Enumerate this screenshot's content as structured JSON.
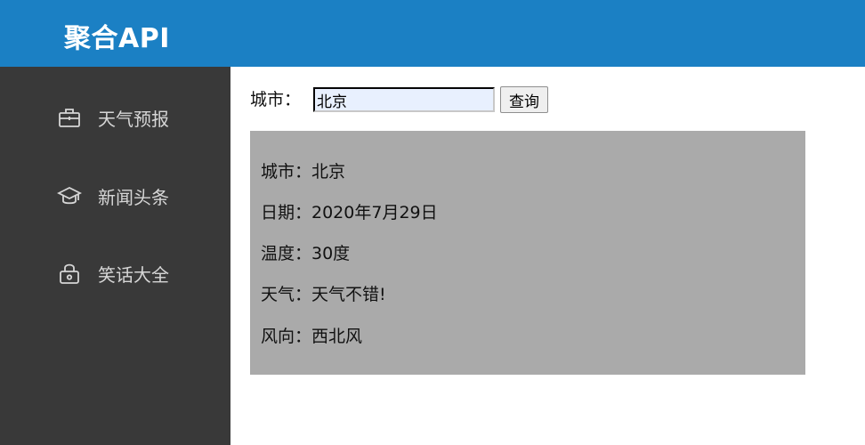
{
  "header": {
    "brand": "聚合API"
  },
  "sidebar": {
    "items": [
      {
        "label": "天气预报",
        "icon": "briefcase-icon"
      },
      {
        "label": "新闻头条",
        "icon": "graduation-cap-icon"
      },
      {
        "label": "笑话大全",
        "icon": "lock-icon"
      }
    ]
  },
  "search": {
    "label": "城市：",
    "value": "北京",
    "button_label": "查询"
  },
  "result": {
    "lines": [
      "城市：北京",
      "日期：2020年7月29日",
      "温度：30度",
      "天气：天气不错!",
      "风向：西北风"
    ]
  },
  "colors": {
    "header_bg": "#1b80c4",
    "sidebar_bg": "#393939",
    "panel_bg": "#aaaaaa"
  }
}
